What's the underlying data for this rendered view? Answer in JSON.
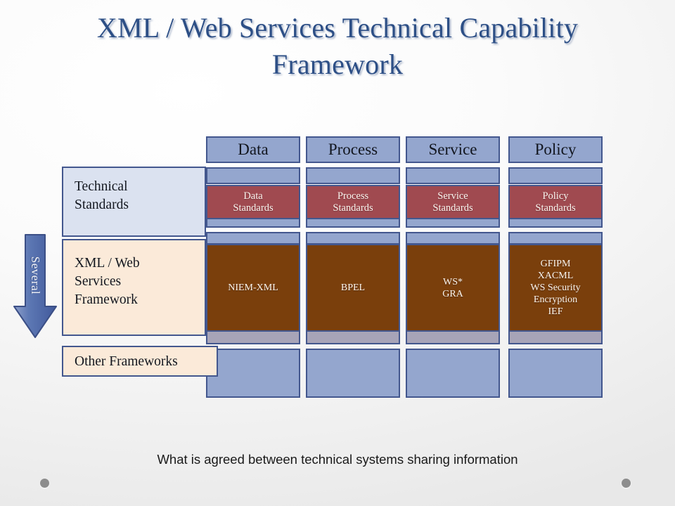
{
  "slide": {
    "title": "XML / Web Services Technical  Capability\nFramework",
    "caption": "What is agreed between technical systems sharing information"
  },
  "arrow": {
    "label": "Several"
  },
  "row_labels": [
    {
      "id": "technical-standards",
      "text": "Technical\nStandards"
    },
    {
      "id": "xml-web-services-framework",
      "text": "XML / Web\nServices\nFramework"
    },
    {
      "id": "other-frameworks",
      "text": "Other Frameworks"
    }
  ],
  "columns": [
    {
      "header": "Data",
      "standards": "Data\nStandards",
      "framework": "NIEM-XML"
    },
    {
      "header": "Process",
      "standards": "Process\nStandards",
      "framework": "BPEL"
    },
    {
      "header": "Service",
      "standards": "Service\nStandards",
      "framework": "WS*\nGRA"
    },
    {
      "header": "Policy",
      "standards": "Policy\nStandards",
      "framework": "GFIPM\nXACML\nWS Security\nEncryption\nIEF"
    }
  ],
  "colors": {
    "title": "#2d4f86",
    "cell_blue": "#94a6ce",
    "cell_border": "#43578e",
    "standards_red": "#a04a50",
    "framework_brown": "#7a3f0c",
    "row_tech_bg": "#dbe2f0",
    "row_xml_bg": "#fbead9",
    "other_row_bg": "#a7a4b8",
    "arrow_blue": "#5670ad",
    "dot_gray": "#8d8d8d"
  }
}
